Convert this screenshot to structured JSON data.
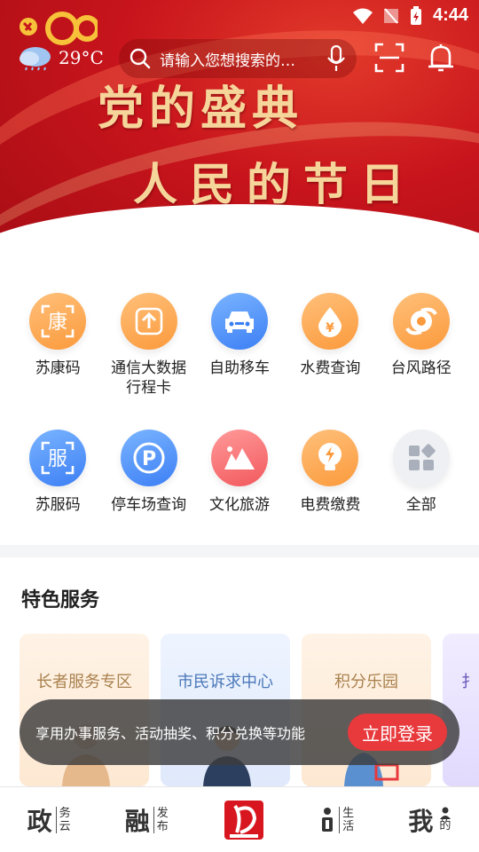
{
  "status_bar": {
    "time": "4:44"
  },
  "header": {
    "weather_temp": "29°C",
    "search_placeholder": "请输入您想搜索的…",
    "icons": [
      "mic-icon",
      "scan-icon",
      "bell-icon"
    ]
  },
  "banner": {
    "line1": "党的盛典",
    "line2": "人民的节日",
    "page_count": 5,
    "active_page": 1,
    "colors": {
      "background": "#c8141c",
      "text": "#f6d59a"
    }
  },
  "services": [
    {
      "label": "苏康码",
      "icon": "kang-icon",
      "color": "orange"
    },
    {
      "label": "通信大数据行程卡",
      "icon": "upload-arrow-icon",
      "color": "orange"
    },
    {
      "label": "自助移车",
      "icon": "car-icon",
      "color": "blue"
    },
    {
      "label": "水费查询",
      "icon": "water-drop-icon",
      "color": "orange"
    },
    {
      "label": "台风路径",
      "icon": "typhoon-icon",
      "color": "orange"
    },
    {
      "label": "苏服码",
      "icon": "fu-icon",
      "color": "blue"
    },
    {
      "label": "停车场查询",
      "icon": "parking-icon",
      "color": "blue"
    },
    {
      "label": "文化旅游",
      "icon": "mountain-icon",
      "color": "pink"
    },
    {
      "label": "电费缴费",
      "icon": "lightning-bulb-icon",
      "color": "orange"
    },
    {
      "label": "全部",
      "icon": "all-grid-icon",
      "color": "gray"
    }
  ],
  "special": {
    "title": "特色服务",
    "cards": [
      "长者服务专区",
      "市民诉求中心",
      "积分乐园",
      "扌"
    ]
  },
  "toast": {
    "text": "享用办事服务、活动抽奖、积分兑换等功能",
    "button": "立即登录",
    "button_color": "#e8393c"
  },
  "nav": [
    {
      "big": "政",
      "small1": "务",
      "small2": "云"
    },
    {
      "big": "融",
      "small1": "发",
      "small2": "布"
    },
    {
      "center": true,
      "icon": "app-logo-icon"
    },
    {
      "big": "生",
      "small1": "生",
      "small2": "活"
    },
    {
      "big": "我",
      "small1": "",
      "small2": "的"
    }
  ]
}
